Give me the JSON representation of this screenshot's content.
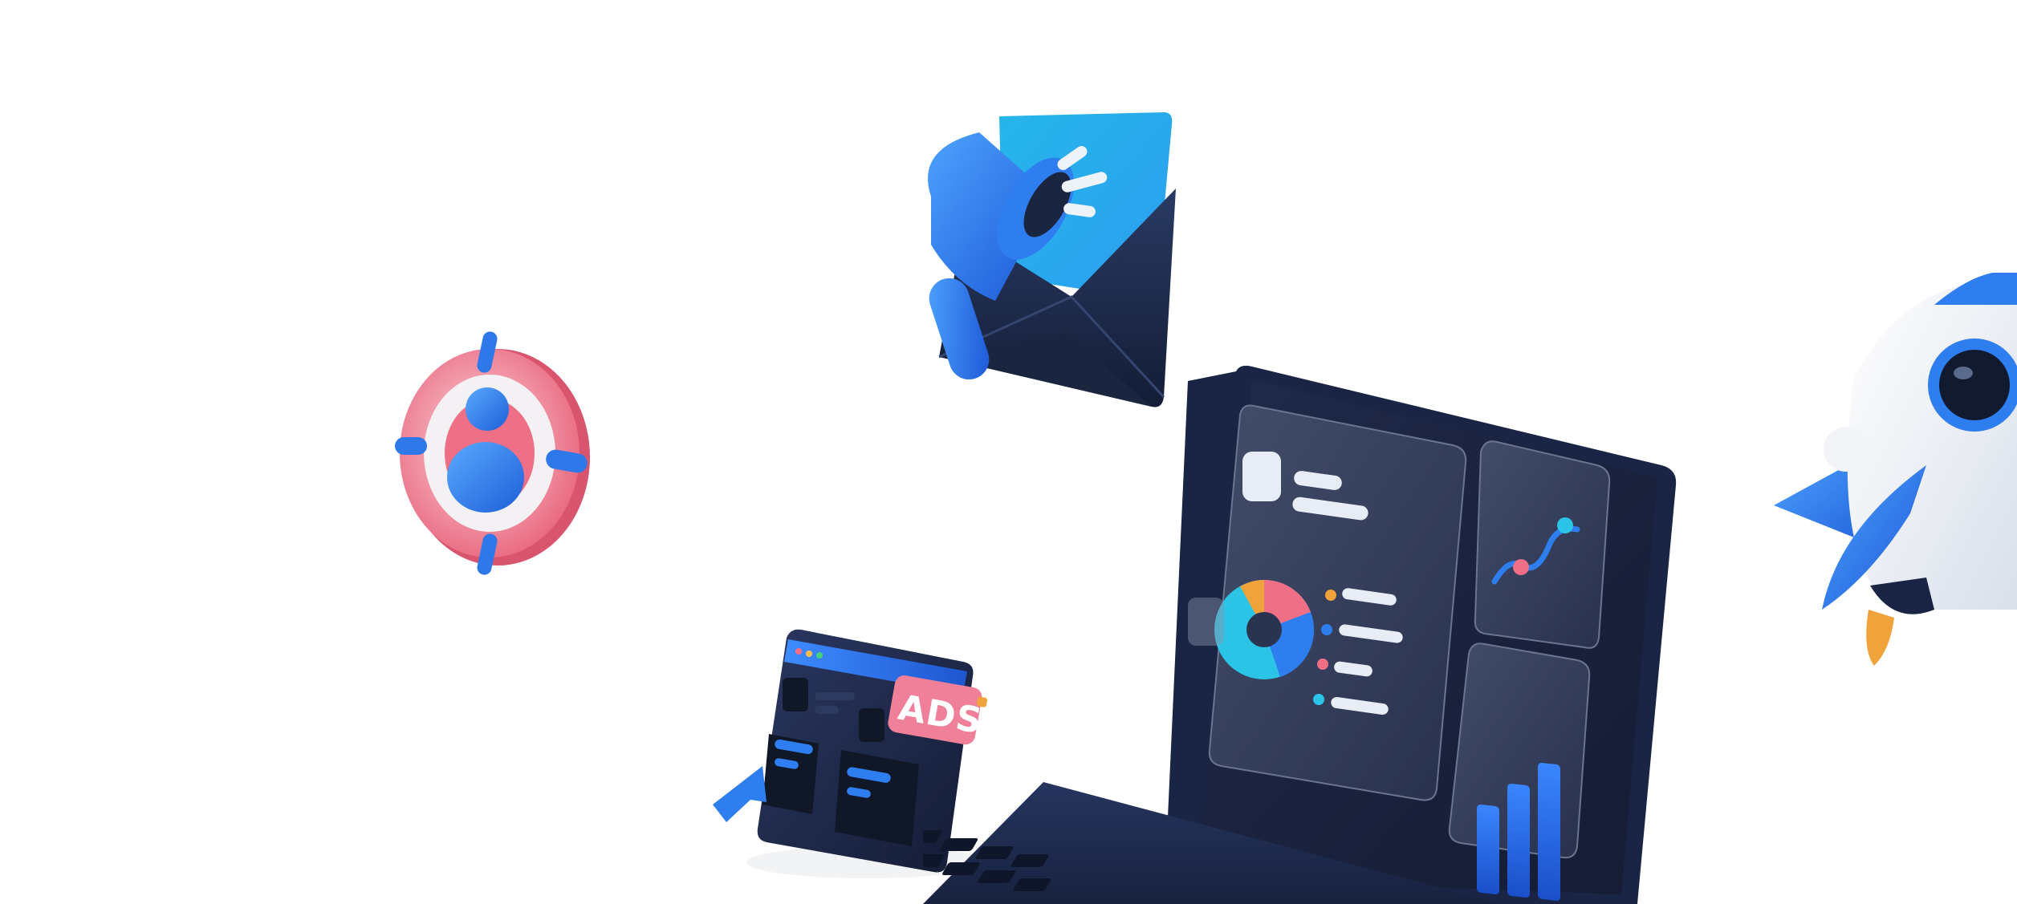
{
  "illustration": {
    "description_free": true,
    "ads_badge": {
      "label": "ADS"
    },
    "colors": {
      "background": "#ffffff",
      "primary_blue": "#2f7ef0",
      "deep_blue": "#1c4fc4",
      "navy": "#1e2a4a",
      "pink": "#ee6f86",
      "light_pink": "#f7c9d2",
      "cyan": "#2cc4e6",
      "orange": "#f0a33a",
      "white": "#f2f4f8"
    },
    "pie_segments_fraction": [
      0.18,
      0.27,
      0.3,
      0.25
    ],
    "bar_levels_fraction": [
      0.55,
      0.7,
      0.85
    ]
  }
}
